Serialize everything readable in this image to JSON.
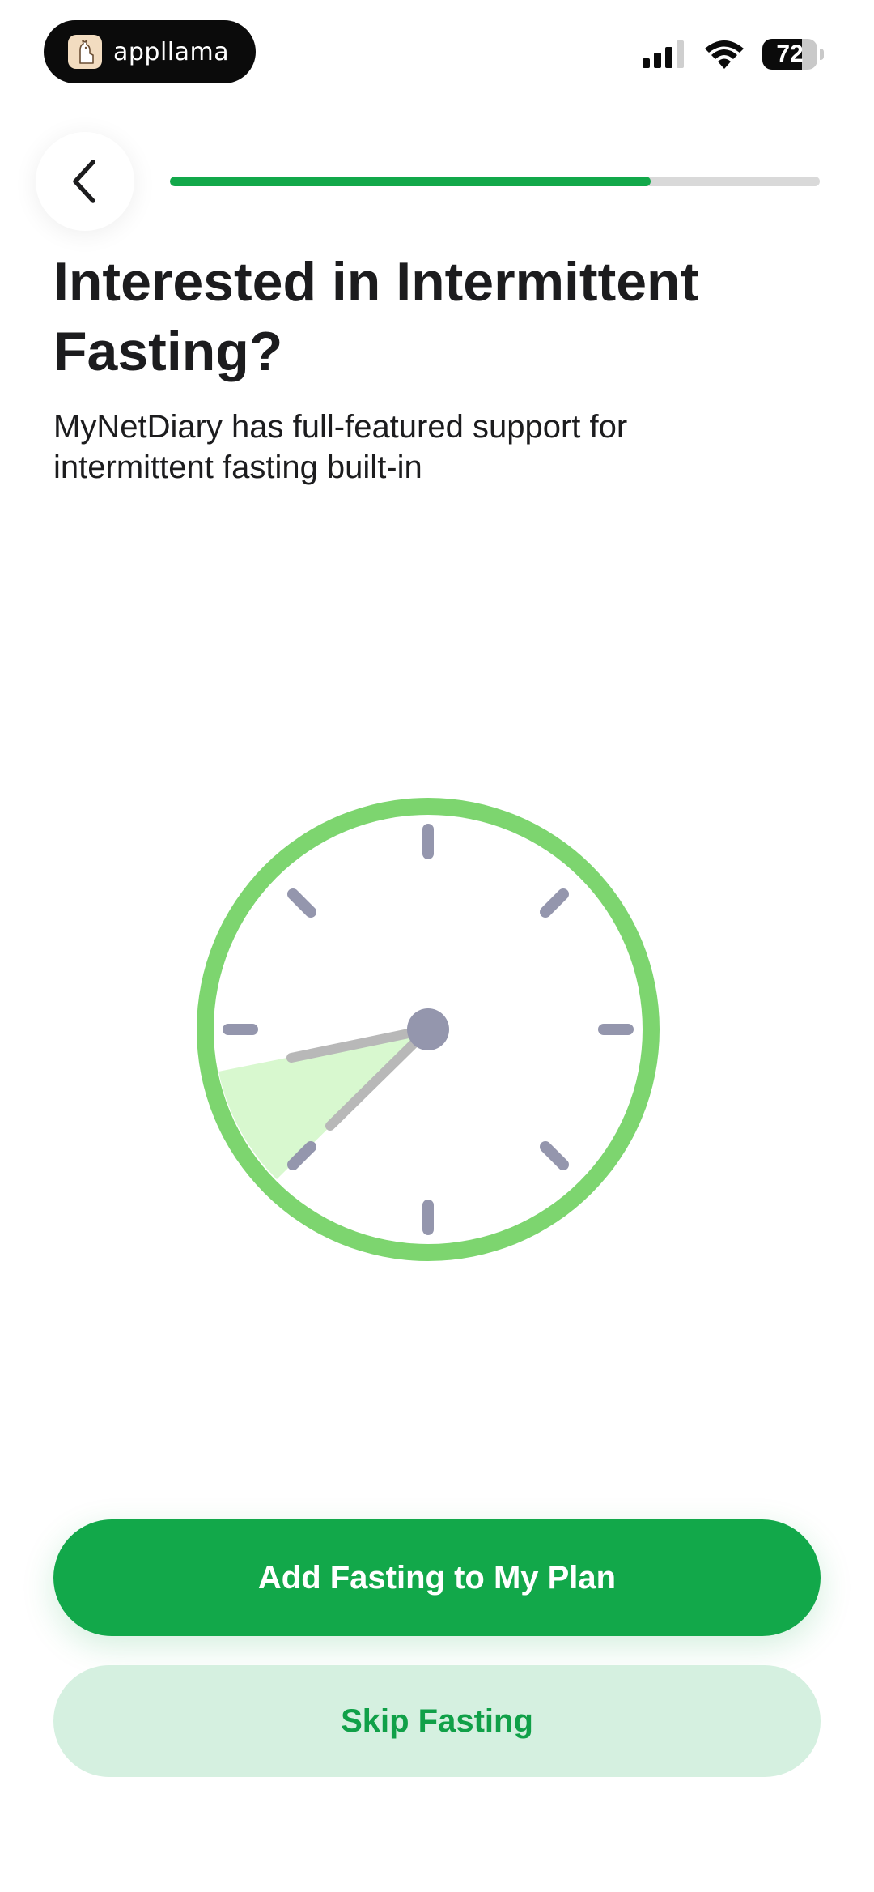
{
  "status_bar": {
    "app_badge": "appllama",
    "battery": "72",
    "battery_level": 0.72,
    "icons": [
      "llama-logo-icon",
      "cellular-signal-icon",
      "wifi-icon",
      "battery-icon"
    ]
  },
  "header": {
    "back_icon": "chevron-left-icon",
    "progress": 0.74
  },
  "content": {
    "title": "Interested in Intermittent Fasting?",
    "subtitle": "MyNetDiary has full-featured support for intermittent fasting built-in",
    "illustration_icon": "clock-icon"
  },
  "actions": {
    "primary_label": "Add Fasting to My Plan",
    "secondary_label": "Skip Fasting"
  },
  "colors": {
    "accent": "#12a84a",
    "secondary_button_bg": "#d5f0e0",
    "clock_ring": "#7dd56f",
    "clock_sector": "#d8f8cf",
    "clock_ticks": "#9496ad",
    "clock_hands": "#b8b8b8"
  }
}
